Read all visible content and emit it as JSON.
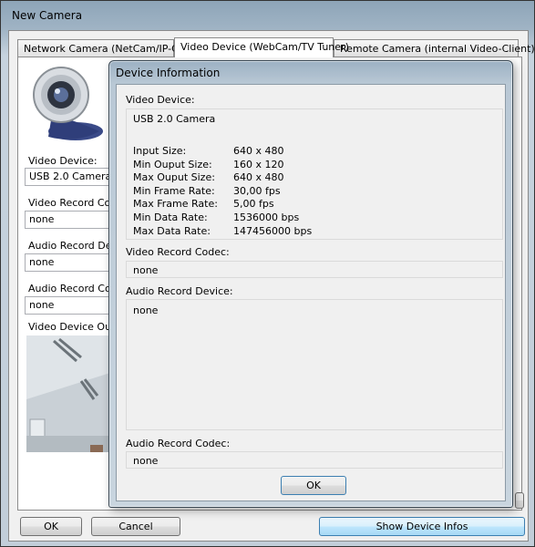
{
  "window": {
    "title": "New Camera"
  },
  "tabs": [
    {
      "label": "Network Camera (NetCam/IP-Cam)"
    },
    {
      "label": "Video Device (WebCam/TV Tuner)"
    },
    {
      "label": "Remote Camera (internal Video-Client)"
    }
  ],
  "form": {
    "video_device_label": "Video Device:",
    "video_device_value": "USB 2.0 Camera",
    "video_codec_label": "Video Record Codec:",
    "video_codec_value": "none",
    "audio_device_label": "Audio Record Device:",
    "audio_device_value": "none",
    "audio_codec_label": "Audio Record Codec:",
    "audio_codec_value": "none",
    "output_label": "Video Device Output:"
  },
  "buttons": {
    "ok": "OK",
    "cancel": "Cancel",
    "show_device_infos": "Show Device Infos"
  },
  "dialog": {
    "title": "Device Information",
    "video_device_label": "Video Device:",
    "video_device_name": "USB 2.0 Camera",
    "specs": [
      {
        "key": "Input Size:",
        "value": "640 x 480"
      },
      {
        "key": "Min Ouput Size:",
        "value": "160 x 120"
      },
      {
        "key": "Max Ouput Size:",
        "value": "640 x 480"
      },
      {
        "key": "Min Frame Rate:",
        "value": "30,00 fps"
      },
      {
        "key": "Max Frame Rate:",
        "value": "5,00 fps"
      },
      {
        "key": "Min Data Rate:",
        "value": "1536000 bps"
      },
      {
        "key": "Max Data Rate:",
        "value": "147456000 bps"
      }
    ],
    "video_codec_label": "Video Record Codec:",
    "video_codec_value": "none",
    "audio_device_label": "Audio Record Device:",
    "audio_device_value": "none",
    "audio_codec_label": "Audio Record Codec:",
    "audio_codec_value": "none",
    "ok_label": "OK"
  },
  "icons": {
    "webcam": "webcam-icon"
  }
}
